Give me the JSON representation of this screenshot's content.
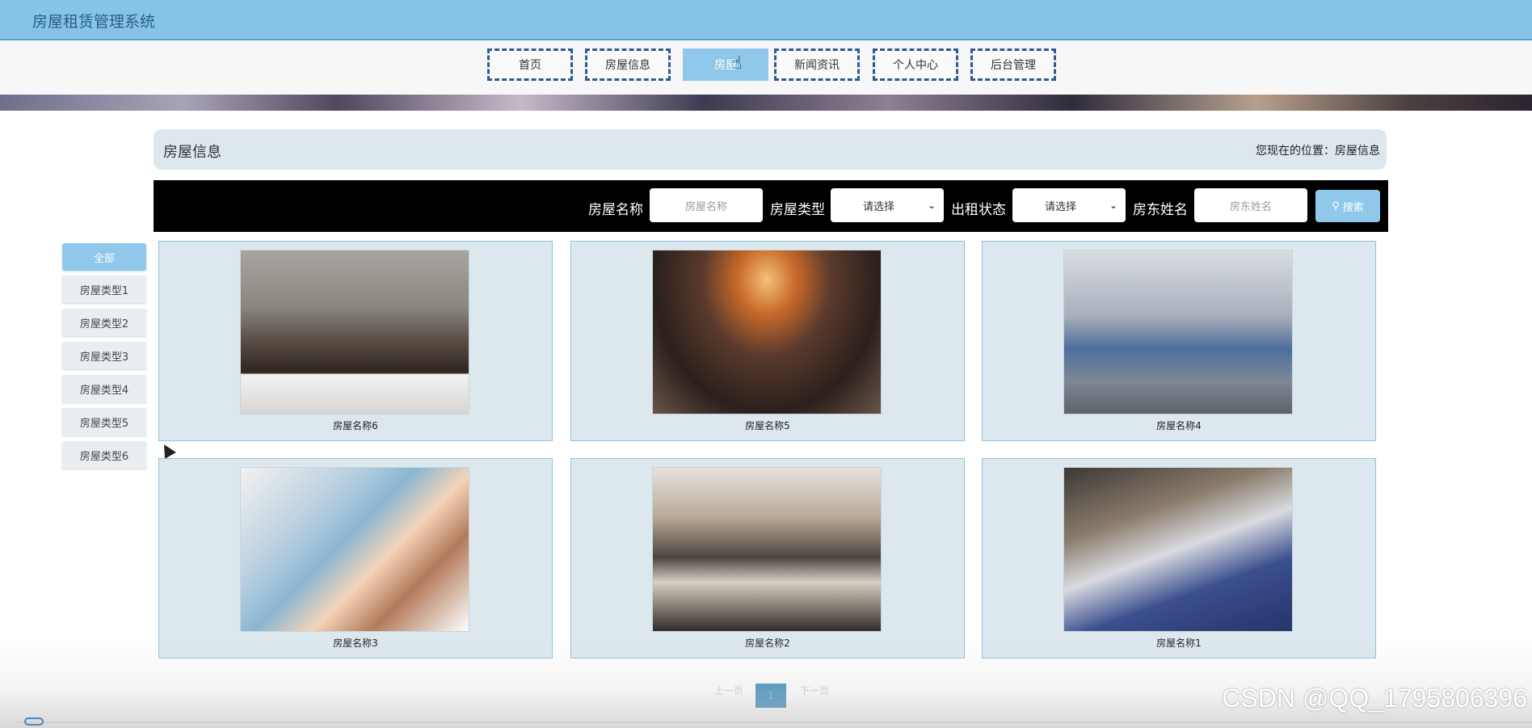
{
  "app": {
    "title": "房屋租赁管理系统"
  },
  "nav": {
    "items": [
      {
        "label": "首页"
      },
      {
        "label": "房屋信息"
      },
      {
        "label": "房屋"
      },
      {
        "label": "新闻资讯"
      },
      {
        "label": "个人中心"
      },
      {
        "label": "后台管理"
      }
    ],
    "active_index": 2
  },
  "section": {
    "title": "房屋信息",
    "breadcrumb": "您现在的位置：房屋信息"
  },
  "search": {
    "name_label": "房屋名称",
    "name_placeholder": "房屋名称",
    "type_label": "房屋类型",
    "type_value": "请选择",
    "status_label": "出租状态",
    "status_value": "请选择",
    "landlord_label": "房东姓名",
    "landlord_placeholder": "房东姓名",
    "button_label": "搜索"
  },
  "sidebar": {
    "items": [
      {
        "label": "全部"
      },
      {
        "label": "房屋类型1"
      },
      {
        "label": "房屋类型2"
      },
      {
        "label": "房屋类型3"
      },
      {
        "label": "房屋类型4"
      },
      {
        "label": "房屋类型5"
      },
      {
        "label": "房屋类型6"
      }
    ],
    "active_index": 0
  },
  "cards": [
    {
      "name": "房屋名称6"
    },
    {
      "name": "房屋名称5"
    },
    {
      "name": "房屋名称4"
    },
    {
      "name": "房屋名称3"
    },
    {
      "name": "房屋名称2"
    },
    {
      "name": "房屋名称1"
    }
  ],
  "pagination": {
    "prev": "上一页",
    "current": "1",
    "next": "下一页"
  },
  "watermark": "CSDN @QQ_1795806396",
  "colors": {
    "accent": "#8fc8ea",
    "topbar": "#86c4e6",
    "nav_border": "#2f5b8f",
    "card_bg": "#dce8ee"
  }
}
